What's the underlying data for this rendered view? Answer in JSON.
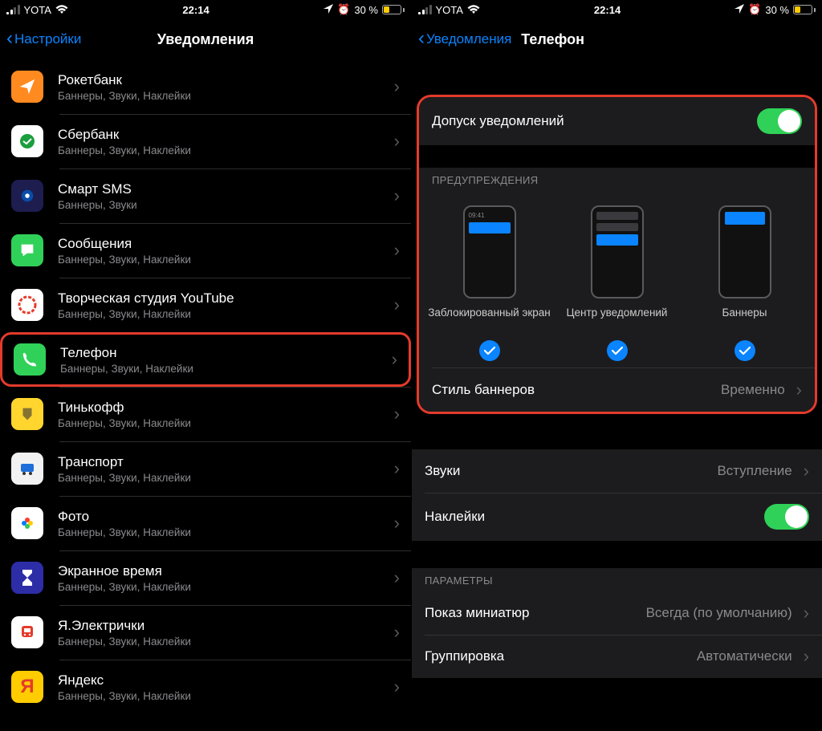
{
  "status": {
    "carrier": "YOTA",
    "time": "22:14",
    "battery_pct": "30 %"
  },
  "left": {
    "back": "Настройки",
    "title": "Уведомления",
    "apps": [
      {
        "name": "Рокетбанк",
        "detail": "Баннеры, Звуки, Наклейки",
        "ic": "ic-rocket"
      },
      {
        "name": "Сбербанк",
        "detail": "Баннеры, Звуки, Наклейки",
        "ic": "ic-sber"
      },
      {
        "name": "Смарт SMS",
        "detail": "Баннеры, Звуки",
        "ic": "ic-sms"
      },
      {
        "name": "Сообщения",
        "detail": "Баннеры, Звуки, Наклейки",
        "ic": "ic-msg"
      },
      {
        "name": "Творческая студия YouTube",
        "detail": "Баннеры, Звуки, Наклейки",
        "ic": "ic-yt"
      },
      {
        "name": "Телефон",
        "detail": "Баннеры, Звуки, Наклейки",
        "ic": "ic-phone",
        "highlight": true
      },
      {
        "name": "Тинькофф",
        "detail": "Баннеры, Звуки, Наклейки",
        "ic": "ic-tink"
      },
      {
        "name": "Транспорт",
        "detail": "Баннеры, Звуки, Наклейки",
        "ic": "ic-trans"
      },
      {
        "name": "Фото",
        "detail": "Баннеры, Звуки, Наклейки",
        "ic": "ic-photo"
      },
      {
        "name": "Экранное время",
        "detail": "Баннеры, Звуки, Наклейки",
        "ic": "ic-screen"
      },
      {
        "name": "Я.Электрички",
        "detail": "Баннеры, Звуки, Наклейки",
        "ic": "ic-train"
      },
      {
        "name": "Яндекс",
        "detail": "Баннеры, Звуки, Наклейки",
        "ic": "ic-yandex"
      }
    ]
  },
  "right": {
    "back": "Уведомления",
    "title": "Телефон",
    "allow": "Допуск уведомлений",
    "alerts_header": "ПРЕДУПРЕЖДЕНИЯ",
    "alerts": {
      "lock": "Заблокированный экран",
      "center": "Центр уведомлений",
      "banners": "Баннеры",
      "lock_time": "09:41"
    },
    "banner_style": {
      "label": "Стиль баннеров",
      "value": "Временно"
    },
    "sounds": {
      "label": "Звуки",
      "value": "Вступление"
    },
    "badges": "Наклейки",
    "params_header": "ПАРАМЕТРЫ",
    "preview": {
      "label": "Показ миниатюр",
      "value": "Всегда (по умолчанию)"
    },
    "grouping": {
      "label": "Группировка",
      "value": "Автоматически"
    }
  }
}
